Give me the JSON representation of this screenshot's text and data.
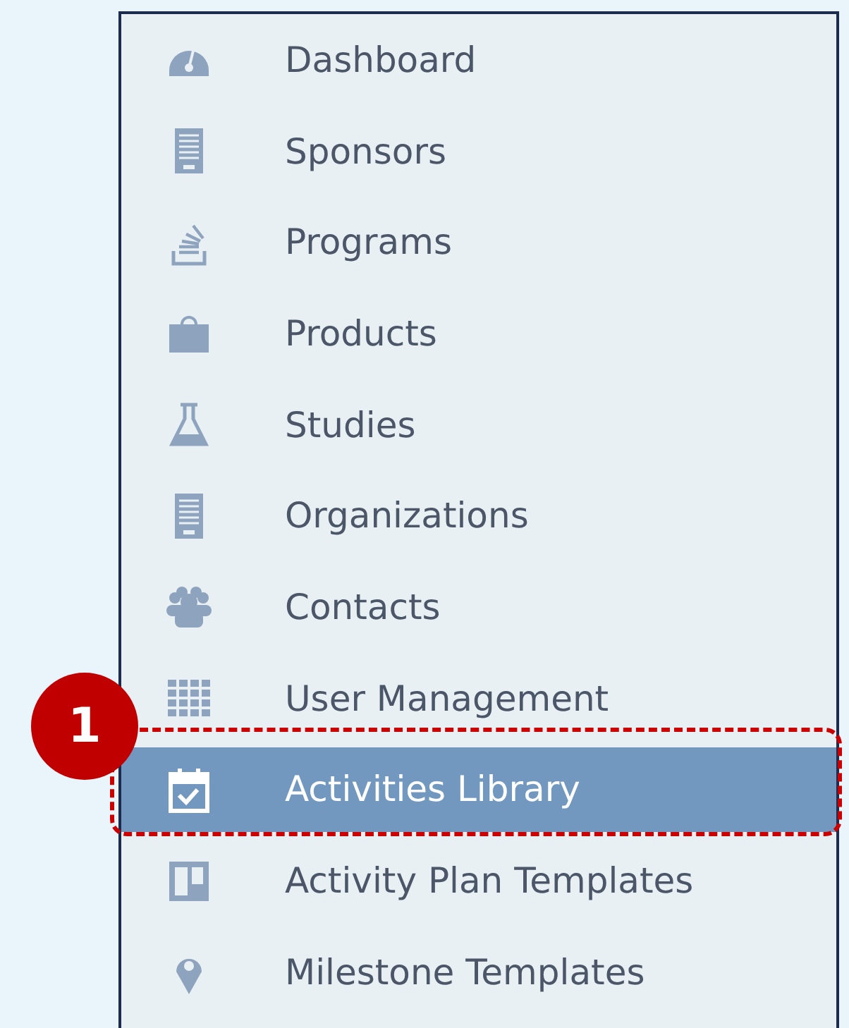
{
  "sidebar": {
    "items": [
      {
        "label": "Dashboard",
        "selected": false
      },
      {
        "label": "Sponsors",
        "selected": false
      },
      {
        "label": "Programs",
        "selected": false
      },
      {
        "label": "Products",
        "selected": false
      },
      {
        "label": "Studies",
        "selected": false
      },
      {
        "label": "Organizations",
        "selected": false
      },
      {
        "label": "Contacts",
        "selected": false
      },
      {
        "label": "User Management",
        "selected": false
      },
      {
        "label": "Activities Library",
        "selected": true
      },
      {
        "label": "Activity Plan Templates",
        "selected": false
      },
      {
        "label": "Milestone Templates",
        "selected": false
      }
    ]
  },
  "callout": {
    "label": "1"
  }
}
